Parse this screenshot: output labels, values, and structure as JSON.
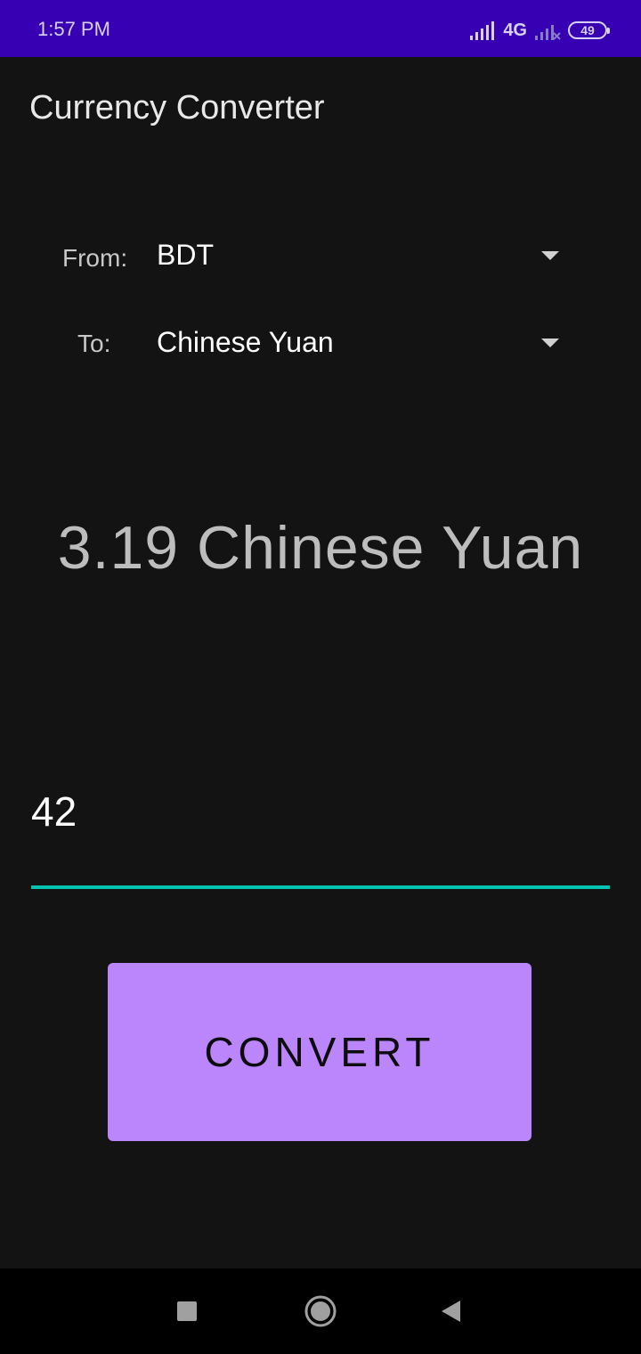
{
  "status_bar": {
    "time": "1:57 PM",
    "network": "4G",
    "battery": "49",
    "background_color": "#3700b3"
  },
  "app_bar": {
    "title": "Currency Converter"
  },
  "converter": {
    "from_label": "From:",
    "from_value": "BDT",
    "to_label": "To:",
    "to_value": "Chinese Yuan",
    "result": "3.19 Chinese Yuan",
    "amount": "42",
    "convert_label": "CONVERT"
  },
  "colors": {
    "background": "#131313",
    "button": "#bb86fc",
    "underline": "#03c4b0"
  },
  "nav_bar": {
    "icons": [
      "recents-square-icon",
      "home-circle-icon",
      "back-triangle-icon"
    ]
  }
}
